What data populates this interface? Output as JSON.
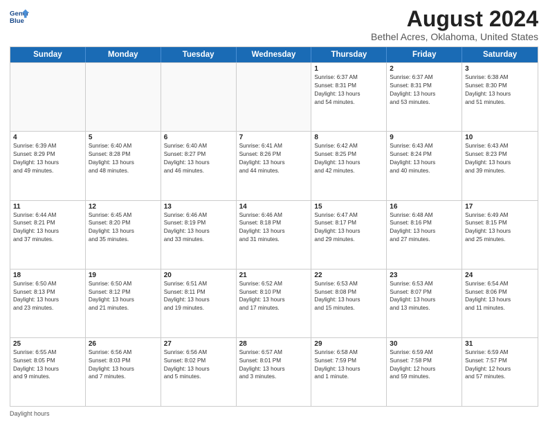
{
  "logo": {
    "line1": "General",
    "line2": "Blue"
  },
  "title": "August 2024",
  "subtitle": "Bethel Acres, Oklahoma, United States",
  "header_days": [
    "Sunday",
    "Monday",
    "Tuesday",
    "Wednesday",
    "Thursday",
    "Friday",
    "Saturday"
  ],
  "footer_label": "Daylight hours",
  "weeks": [
    [
      {
        "day": "",
        "info": ""
      },
      {
        "day": "",
        "info": ""
      },
      {
        "day": "",
        "info": ""
      },
      {
        "day": "",
        "info": ""
      },
      {
        "day": "1",
        "info": "Sunrise: 6:37 AM\nSunset: 8:31 PM\nDaylight: 13 hours\nand 54 minutes."
      },
      {
        "day": "2",
        "info": "Sunrise: 6:37 AM\nSunset: 8:31 PM\nDaylight: 13 hours\nand 53 minutes."
      },
      {
        "day": "3",
        "info": "Sunrise: 6:38 AM\nSunset: 8:30 PM\nDaylight: 13 hours\nand 51 minutes."
      }
    ],
    [
      {
        "day": "4",
        "info": "Sunrise: 6:39 AM\nSunset: 8:29 PM\nDaylight: 13 hours\nand 49 minutes."
      },
      {
        "day": "5",
        "info": "Sunrise: 6:40 AM\nSunset: 8:28 PM\nDaylight: 13 hours\nand 48 minutes."
      },
      {
        "day": "6",
        "info": "Sunrise: 6:40 AM\nSunset: 8:27 PM\nDaylight: 13 hours\nand 46 minutes."
      },
      {
        "day": "7",
        "info": "Sunrise: 6:41 AM\nSunset: 8:26 PM\nDaylight: 13 hours\nand 44 minutes."
      },
      {
        "day": "8",
        "info": "Sunrise: 6:42 AM\nSunset: 8:25 PM\nDaylight: 13 hours\nand 42 minutes."
      },
      {
        "day": "9",
        "info": "Sunrise: 6:43 AM\nSunset: 8:24 PM\nDaylight: 13 hours\nand 40 minutes."
      },
      {
        "day": "10",
        "info": "Sunrise: 6:43 AM\nSunset: 8:23 PM\nDaylight: 13 hours\nand 39 minutes."
      }
    ],
    [
      {
        "day": "11",
        "info": "Sunrise: 6:44 AM\nSunset: 8:21 PM\nDaylight: 13 hours\nand 37 minutes."
      },
      {
        "day": "12",
        "info": "Sunrise: 6:45 AM\nSunset: 8:20 PM\nDaylight: 13 hours\nand 35 minutes."
      },
      {
        "day": "13",
        "info": "Sunrise: 6:46 AM\nSunset: 8:19 PM\nDaylight: 13 hours\nand 33 minutes."
      },
      {
        "day": "14",
        "info": "Sunrise: 6:46 AM\nSunset: 8:18 PM\nDaylight: 13 hours\nand 31 minutes."
      },
      {
        "day": "15",
        "info": "Sunrise: 6:47 AM\nSunset: 8:17 PM\nDaylight: 13 hours\nand 29 minutes."
      },
      {
        "day": "16",
        "info": "Sunrise: 6:48 AM\nSunset: 8:16 PM\nDaylight: 13 hours\nand 27 minutes."
      },
      {
        "day": "17",
        "info": "Sunrise: 6:49 AM\nSunset: 8:15 PM\nDaylight: 13 hours\nand 25 minutes."
      }
    ],
    [
      {
        "day": "18",
        "info": "Sunrise: 6:50 AM\nSunset: 8:13 PM\nDaylight: 13 hours\nand 23 minutes."
      },
      {
        "day": "19",
        "info": "Sunrise: 6:50 AM\nSunset: 8:12 PM\nDaylight: 13 hours\nand 21 minutes."
      },
      {
        "day": "20",
        "info": "Sunrise: 6:51 AM\nSunset: 8:11 PM\nDaylight: 13 hours\nand 19 minutes."
      },
      {
        "day": "21",
        "info": "Sunrise: 6:52 AM\nSunset: 8:10 PM\nDaylight: 13 hours\nand 17 minutes."
      },
      {
        "day": "22",
        "info": "Sunrise: 6:53 AM\nSunset: 8:08 PM\nDaylight: 13 hours\nand 15 minutes."
      },
      {
        "day": "23",
        "info": "Sunrise: 6:53 AM\nSunset: 8:07 PM\nDaylight: 13 hours\nand 13 minutes."
      },
      {
        "day": "24",
        "info": "Sunrise: 6:54 AM\nSunset: 8:06 PM\nDaylight: 13 hours\nand 11 minutes."
      }
    ],
    [
      {
        "day": "25",
        "info": "Sunrise: 6:55 AM\nSunset: 8:05 PM\nDaylight: 13 hours\nand 9 minutes."
      },
      {
        "day": "26",
        "info": "Sunrise: 6:56 AM\nSunset: 8:03 PM\nDaylight: 13 hours\nand 7 minutes."
      },
      {
        "day": "27",
        "info": "Sunrise: 6:56 AM\nSunset: 8:02 PM\nDaylight: 13 hours\nand 5 minutes."
      },
      {
        "day": "28",
        "info": "Sunrise: 6:57 AM\nSunset: 8:01 PM\nDaylight: 13 hours\nand 3 minutes."
      },
      {
        "day": "29",
        "info": "Sunrise: 6:58 AM\nSunset: 7:59 PM\nDaylight: 13 hours\nand 1 minute."
      },
      {
        "day": "30",
        "info": "Sunrise: 6:59 AM\nSunset: 7:58 PM\nDaylight: 12 hours\nand 59 minutes."
      },
      {
        "day": "31",
        "info": "Sunrise: 6:59 AM\nSunset: 7:57 PM\nDaylight: 12 hours\nand 57 minutes."
      }
    ]
  ]
}
